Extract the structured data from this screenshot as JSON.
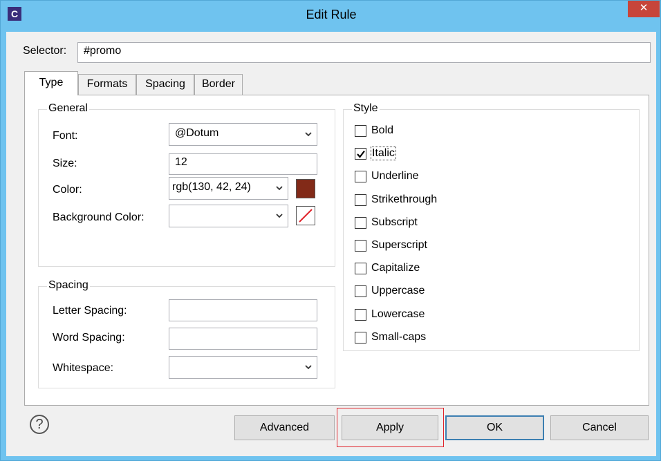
{
  "window": {
    "title": "Edit Rule",
    "app_icon": "C",
    "close_glyph": "✕"
  },
  "selector": {
    "label": "Selector:",
    "value": "#promo"
  },
  "tabs": [
    {
      "label": "Type",
      "active": true
    },
    {
      "label": "Formats",
      "active": false
    },
    {
      "label": "Spacing",
      "active": false
    },
    {
      "label": "Border",
      "active": false
    }
  ],
  "general": {
    "title": "General",
    "font_label": "Font:",
    "font_value": "@Dotum",
    "size_label": "Size:",
    "size_value": "12",
    "color_label": "Color:",
    "color_value": "rgb(130, 42, 24)",
    "color_swatch": "#822a18",
    "bg_color_label": "Background Color:",
    "bg_color_value": ""
  },
  "spacing": {
    "title": "Spacing",
    "letter_label": "Letter Spacing:",
    "letter_value": "",
    "word_label": "Word Spacing:",
    "word_value": "",
    "whitespace_label": "Whitespace:",
    "whitespace_value": ""
  },
  "style": {
    "title": "Style",
    "options": [
      {
        "label": "Bold",
        "checked": false
      },
      {
        "label": "Italic",
        "checked": true
      },
      {
        "label": "Underline",
        "checked": false
      },
      {
        "label": "Strikethrough",
        "checked": false
      },
      {
        "label": "Subscript",
        "checked": false
      },
      {
        "label": "Superscript",
        "checked": false
      },
      {
        "label": "Capitalize",
        "checked": false
      },
      {
        "label": "Uppercase",
        "checked": false
      },
      {
        "label": "Lowercase",
        "checked": false
      },
      {
        "label": "Small-caps",
        "checked": false
      }
    ]
  },
  "buttons": {
    "help": "?",
    "advanced": "Advanced",
    "apply": "Apply",
    "ok": "OK",
    "cancel": "Cancel"
  },
  "colors": {
    "titlebar": "#6fc3ef",
    "close": "#c7453a",
    "highlight": "#e0242b",
    "default_button": "#3c7fb1"
  },
  "icons": {
    "help": "help-icon",
    "close": "close-icon",
    "chevron": "chevron-down-icon",
    "no_color": "no-color-icon",
    "check": "check-icon"
  }
}
